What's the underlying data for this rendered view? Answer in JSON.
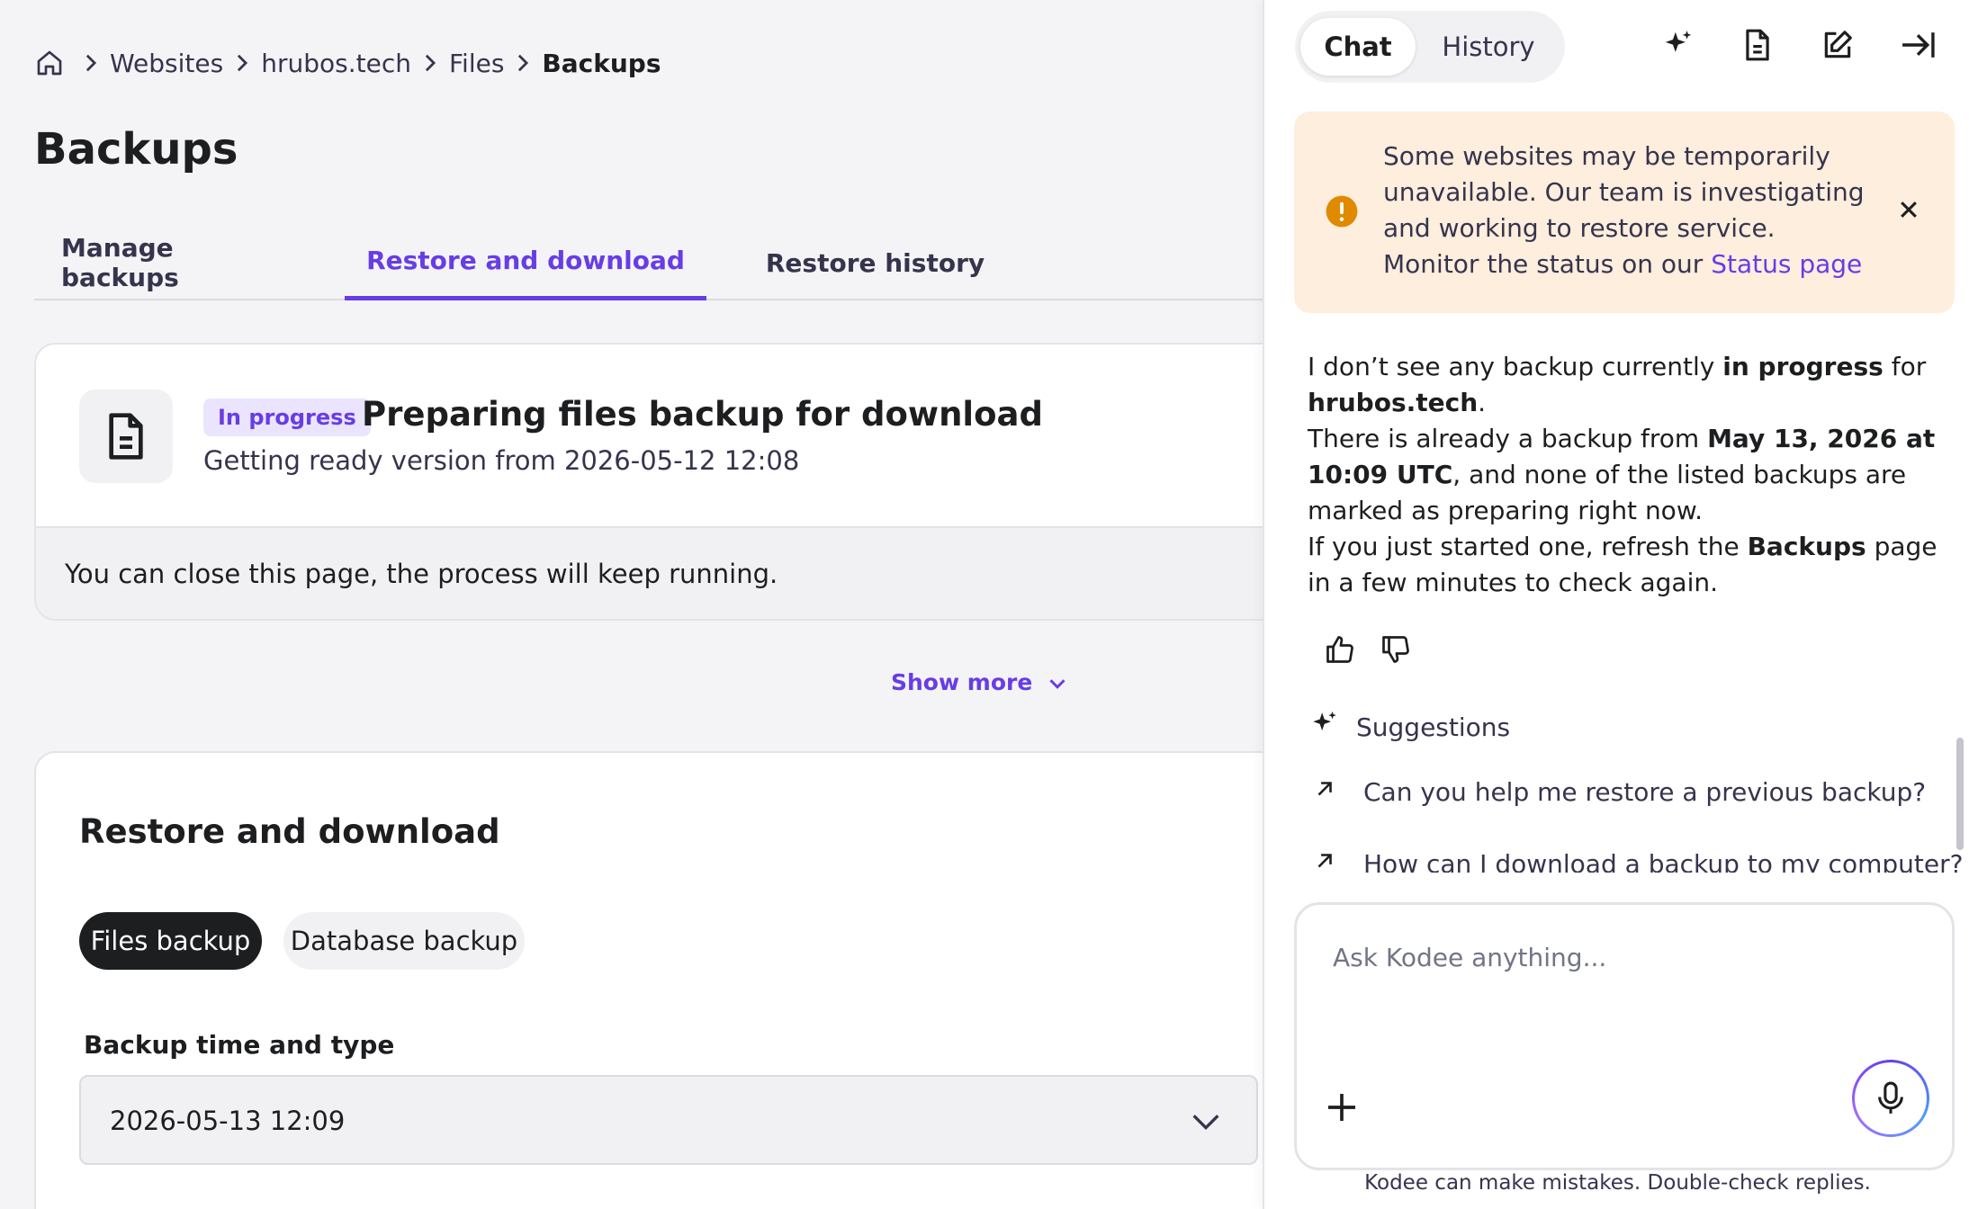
{
  "breadcrumb": {
    "items": [
      "Websites",
      "hrubos.tech",
      "Files",
      "Backups"
    ]
  },
  "page": {
    "title": "Backups"
  },
  "tabs": [
    {
      "label": "Manage backups",
      "active": false
    },
    {
      "label": "Restore and download",
      "active": true
    },
    {
      "label": "Restore history",
      "active": false
    }
  ],
  "progress_card": {
    "badge": "In progress",
    "title": "Preparing files backup for download",
    "subtitle": "Getting ready version from 2026-05-12 12:08",
    "note": "You can close this page, the process will keep running."
  },
  "show_more": "Show more",
  "restore_card": {
    "heading": "Restore and download",
    "chips": [
      "Files backup",
      "Database backup"
    ],
    "field_label": "Backup time and type",
    "selected_value": "2026-05-13 12:09"
  },
  "chat": {
    "tabs": [
      "Chat",
      "History"
    ],
    "alert": {
      "line1": "Some websites may be temporarily unavailable. Our team is investigating and working to restore service.",
      "line2_prefix": "Monitor the status on our ",
      "link": "Status page"
    },
    "message": {
      "p1_a": "I don’t see any backup currently ",
      "p1_b": "in progress",
      "p1_c": " for ",
      "p1_d": "hrubos.tech",
      "p1_e": ".",
      "p2_a": "There is already a backup from ",
      "p2_b": "May 13, 2026 at 10:09 UTC",
      "p2_c": ", and none of the listed backups are marked as preparing right now.",
      "p3_a": "If you just started one, refresh the ",
      "p3_b": "Backups",
      "p3_c": " page in a few minutes to check again."
    },
    "suggestions_title": "Suggestions",
    "suggestions": [
      "Can you help me restore a previous backup?",
      "How can I download a backup to my computer?"
    ],
    "input_placeholder": "Ask Kodee anything...",
    "disclaimer": "Kodee can make mistakes. Double-check replies."
  },
  "colors": {
    "accent": "#673de6",
    "alert_bg": "#fdeedd",
    "warning": "#e08a00",
    "dark": "#1d1e20"
  }
}
